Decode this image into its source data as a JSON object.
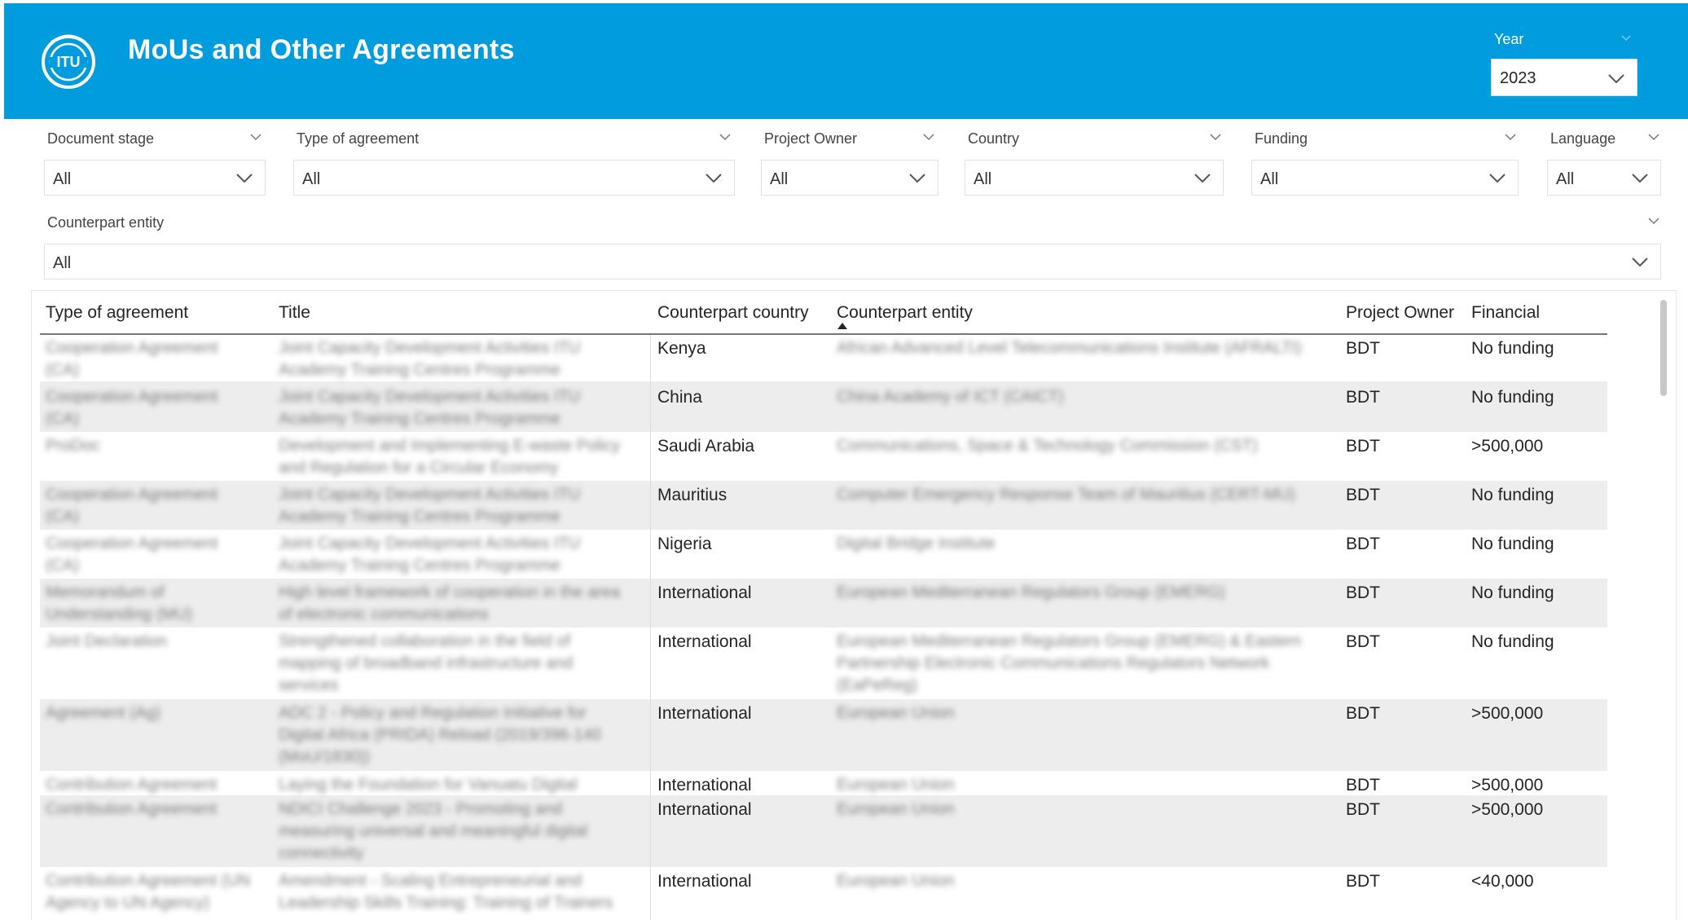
{
  "header": {
    "logo_text": "ITU",
    "title": "MoUs and Other Agreements",
    "year_label": "Year",
    "year_value": "2023",
    "bg_color": "#009cdd"
  },
  "slicers": [
    {
      "label": "Document stage",
      "value": "All"
    },
    {
      "label": "Type of agreement",
      "value": "All"
    },
    {
      "label": "Project Owner",
      "value": "All"
    },
    {
      "label": "Country",
      "value": "All"
    },
    {
      "label": "Funding",
      "value": "All"
    },
    {
      "label": "Language",
      "value": "All"
    },
    {
      "label": "Counterpart entity",
      "value": "All"
    }
  ],
  "table": {
    "columns": [
      "Type of agreement",
      "Title",
      "Counterpart country",
      "Counterpart entity",
      "Project Owner",
      "Financial"
    ],
    "rows": [
      {
        "type": "Cooperation Agreement (CA)",
        "title": "Joint Capacity Development Activities ITU Academy Training Centres Programme",
        "country": "Kenya",
        "entity": "African Advanced Level Telecommunications Institute (AFRALTI)",
        "owner": "BDT",
        "financial": "No funding"
      },
      {
        "type": "Cooperation Agreement (CA)",
        "title": "Joint Capacity Development Activities ITU Academy Training Centres Programme",
        "country": "China",
        "entity": "China Academy of ICT (CAICT)",
        "owner": "BDT",
        "financial": "No funding"
      },
      {
        "type": "ProDoc",
        "title": "Development and Implementing E-waste Policy and Regulation for a Circular Economy",
        "country": "Saudi Arabia",
        "entity": "Communications, Space & Technology Commission (CST)",
        "owner": "BDT",
        "financial": ">500,000"
      },
      {
        "type": "Cooperation Agreement (CA)",
        "title": "Joint Capacity Development Activities ITU Academy Training Centres Programme",
        "country": "Mauritius",
        "entity": "Computer Emergency Response Team of Mauritius (CERT-MU)",
        "owner": "BDT",
        "financial": "No funding"
      },
      {
        "type": "Cooperation Agreement (CA)",
        "title": "Joint Capacity Development Activities ITU Academy Training Centres Programme",
        "country": "Nigeria",
        "entity": "Digital Bridge Institute",
        "owner": "BDT",
        "financial": "No funding"
      },
      {
        "type": "Memorandum of Understanding (MU)",
        "title": "High level framework of cooperation in the area of electronic communications",
        "country": "International",
        "entity": "European Mediterranean Regulators Group (EMERG)",
        "owner": "BDT",
        "financial": "No funding"
      },
      {
        "type": "Joint Declaration",
        "title": "Strengthened collaboration in the field of mapping of broadband infrastructure and services",
        "country": "International",
        "entity": "European Mediterranean Regulators Group (EMERG) & Eastern Partnership Electronic Communications Regulators Network (EaPeReg)",
        "owner": "BDT",
        "financial": "No funding"
      },
      {
        "type": "Agreement (Ag)",
        "title": "ADC 2 - Policy and Regulation Initiative for Digital Africa (PRIDA) Reload (2019/396-140 (MoU/1830))",
        "country": "International",
        "entity": "European Union",
        "owner": "BDT",
        "financial": ">500,000"
      },
      {
        "type": "Contribution Agreement",
        "title": "Laying the Foundation for Vanuatu Digital",
        "country": "International",
        "entity": "European Union",
        "owner": "BDT",
        "financial": ">500,000"
      },
      {
        "type": "Contribution Agreement",
        "title": "NDICI Challenge 2023 - Promoting and measuring universal and meaningful digital connectivity",
        "country": "International",
        "entity": "European Union",
        "owner": "BDT",
        "financial": ">500,000"
      },
      {
        "type": "Contribution Agreement (UN Agency to UN Agency)",
        "title": "Amendment - Scaling Entrepreneurial and Leadership Skills Training: Training of Trainers",
        "country": "International",
        "entity": "European Union",
        "owner": "BDT",
        "financial": "<40,000"
      }
    ]
  }
}
